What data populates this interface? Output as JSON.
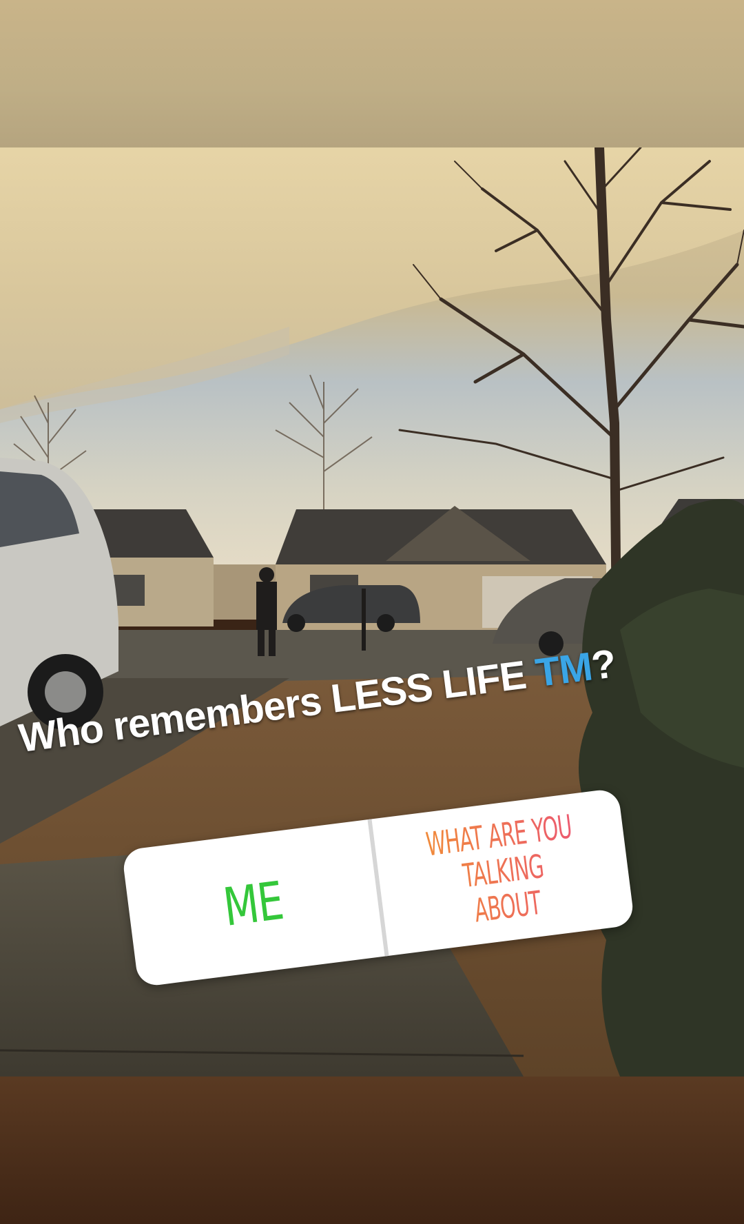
{
  "story": {
    "question_main": "Who remembers LESS LIFE ",
    "question_tm": "TM",
    "question_end": "?"
  },
  "poll": {
    "option_yes": "ME",
    "option_no_line1": "WHAT ARE YOU",
    "option_no_line2": "TALKING ABOUT"
  },
  "colors": {
    "yes_option": "#34c73a",
    "no_option_start": "#f08a3a",
    "no_option_end": "#ec5a6f",
    "tm_accent": "#3aa5e6"
  }
}
